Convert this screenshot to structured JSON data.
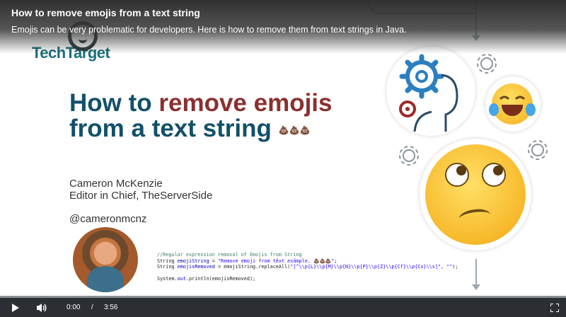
{
  "video": {
    "title": "How to remove emojis from a text string",
    "description": "Emojis can be very problematic for developers. Here is how to remove them from text strings in Java."
  },
  "slide": {
    "logo_text": "TechTarget",
    "title_line1_a": "How to ",
    "title_line1_b": "remove emojis",
    "title_line2": "from a text string",
    "title_emoji": "💩💩💩",
    "author_name": "Cameron McKenzie",
    "author_role": "Editor in Chief, TheServerSide",
    "author_handle": "@cameronmcnz",
    "code": {
      "comment": "//Regular expression removal of Emojis from String",
      "line1_a": "String ",
      "line1_var": "emojiString",
      "line1_b": " = ",
      "line1_str": "\"Remove emoji from têxt exâmple. 💩💩💩\"",
      "line1_end": ";",
      "line2_a": "String ",
      "line2_var": "emojisRemoved",
      "line2_b": " = emojiString.replaceAll(",
      "line2_str": "\"[^\\\\p{L}\\\\p{M}\\\\p{N}\\\\p{P}\\\\p{Z}\\\\p{Cf}\\\\p{Cs}\\\\s]\", \"\"",
      "line2_end": ");",
      "line3_a": "System.",
      "line3_out": "out",
      "line3_b": ".println(emojisRemoved);"
    }
  },
  "player": {
    "current_time": "0:00",
    "separator": "/",
    "duration": "3:56",
    "progress_fraction": 0.0,
    "icons": {
      "play": "play-icon",
      "volume": "volume-icon",
      "fullscreen": "fullscreen-icon"
    }
  },
  "colors": {
    "title_blue": "#13506a",
    "title_red": "#8b2f2f",
    "logo_teal": "#1a6f7a",
    "control_bar": "#2b2e33"
  }
}
